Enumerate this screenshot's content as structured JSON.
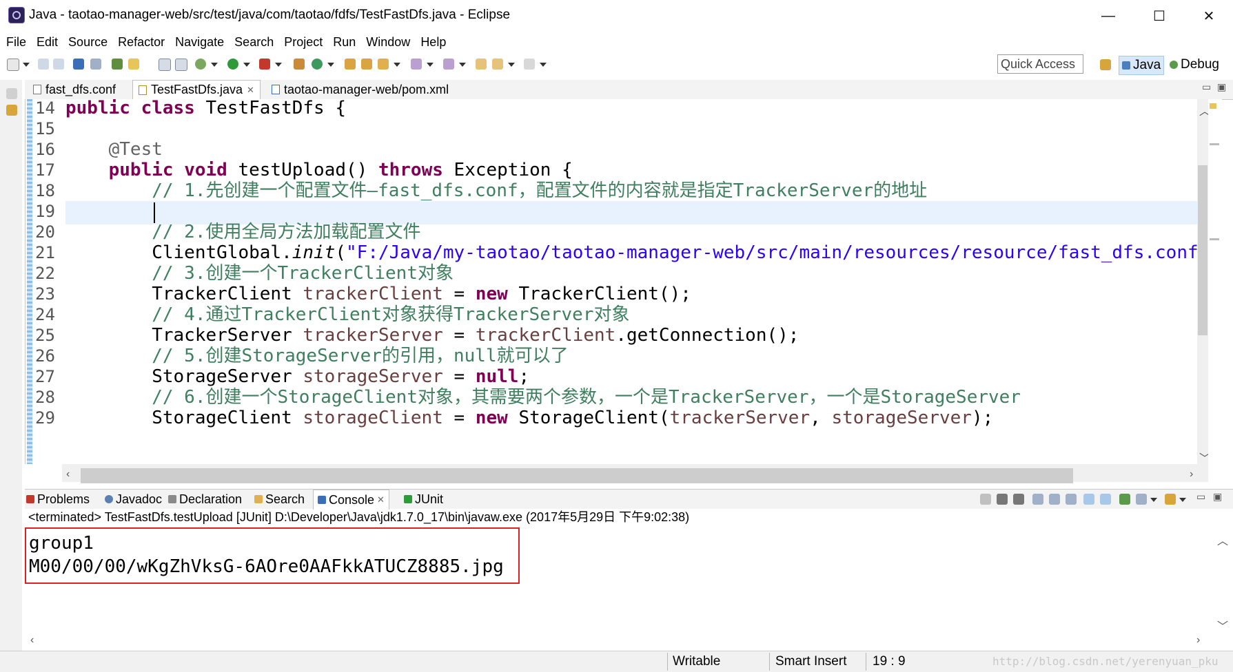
{
  "window": {
    "title": "Java - taotao-manager-web/src/test/java/com/taotao/fdfs/TestFastDfs.java - Eclipse",
    "minimize": "—",
    "maximize": "☐",
    "close": "✕"
  },
  "menu": [
    "File",
    "Edit",
    "Source",
    "Refactor",
    "Navigate",
    "Search",
    "Project",
    "Run",
    "Window",
    "Help"
  ],
  "toolbar": {
    "quick_access": "Quick Access",
    "perspectives": [
      "Java",
      "Debug"
    ]
  },
  "editor": {
    "tabs": [
      {
        "label": "fast_dfs.conf"
      },
      {
        "label": "TestFastDfs.java",
        "active": true
      },
      {
        "label": "taotao-manager-web/pom.xml"
      }
    ],
    "current_line": 19,
    "lines": [
      {
        "n": "14",
        "tokens": [
          {
            "t": "public class",
            "c": "kw"
          },
          {
            "t": " TestFastDfs {",
            "c": ""
          }
        ]
      },
      {
        "n": "15",
        "tokens": []
      },
      {
        "n": "16",
        "tokens": [
          {
            "t": "    ",
            "c": ""
          },
          {
            "t": "@Test",
            "c": "ann"
          }
        ]
      },
      {
        "n": "17",
        "tokens": [
          {
            "t": "    ",
            "c": ""
          },
          {
            "t": "public void",
            "c": "kw"
          },
          {
            "t": " testUpload() ",
            "c": ""
          },
          {
            "t": "throws",
            "c": "kw"
          },
          {
            "t": " Exception {",
            "c": ""
          }
        ]
      },
      {
        "n": "18",
        "tokens": [
          {
            "t": "        // 1.先创建一个配置文件—fast_dfs.conf，配置文件的内容就是指定TrackerServer的地址",
            "c": "cm"
          }
        ]
      },
      {
        "n": "19",
        "tokens": []
      },
      {
        "n": "20",
        "tokens": [
          {
            "t": "        // 2.使用全局方法加载配置文件",
            "c": "cm"
          }
        ]
      },
      {
        "n": "21",
        "tokens": [
          {
            "t": "        ClientGlobal.",
            "c": ""
          },
          {
            "t": "init",
            "c": "it"
          },
          {
            "t": "(",
            "c": ""
          },
          {
            "t": "\"F:/Java/my-taotao/taotao-manager-web/src/main/resources/resource/fast_dfs.conf\"",
            "c": "str"
          },
          {
            "t": ");",
            "c": ""
          }
        ]
      },
      {
        "n": "22",
        "tokens": [
          {
            "t": "        // 3.创建一个TrackerClient对象",
            "c": "cm"
          }
        ]
      },
      {
        "n": "23",
        "tokens": [
          {
            "t": "        TrackerClient ",
            "c": ""
          },
          {
            "t": "trackerClient",
            "c": "fld"
          },
          {
            "t": " = ",
            "c": ""
          },
          {
            "t": "new",
            "c": "kw"
          },
          {
            "t": " TrackerClient();",
            "c": ""
          }
        ]
      },
      {
        "n": "24",
        "tokens": [
          {
            "t": "        // 4.通过TrackerClient对象获得TrackerServer对象",
            "c": "cm"
          }
        ]
      },
      {
        "n": "25",
        "tokens": [
          {
            "t": "        TrackerServer ",
            "c": ""
          },
          {
            "t": "trackerServer",
            "c": "fld"
          },
          {
            "t": " = ",
            "c": ""
          },
          {
            "t": "trackerClient",
            "c": "fld"
          },
          {
            "t": ".getConnection();",
            "c": ""
          }
        ]
      },
      {
        "n": "26",
        "tokens": [
          {
            "t": "        // 5.创建StorageServer的引用，null就可以了",
            "c": "cm"
          }
        ]
      },
      {
        "n": "27",
        "tokens": [
          {
            "t": "        StorageServer ",
            "c": ""
          },
          {
            "t": "storageServer",
            "c": "fld"
          },
          {
            "t": " = ",
            "c": ""
          },
          {
            "t": "null",
            "c": "kw"
          },
          {
            "t": ";",
            "c": ""
          }
        ]
      },
      {
        "n": "28",
        "tokens": [
          {
            "t": "        // 6.创建一个StorageClient对象，其需要两个参数，一个是TrackerServer，一个是StorageServer",
            "c": "cm"
          }
        ]
      },
      {
        "n": "29",
        "tokens": [
          {
            "t": "        StorageClient ",
            "c": ""
          },
          {
            "t": "storageClient",
            "c": "fld"
          },
          {
            "t": " = ",
            "c": ""
          },
          {
            "t": "new",
            "c": "kw"
          },
          {
            "t": " StorageClient(",
            "c": ""
          },
          {
            "t": "trackerServer",
            "c": "fld"
          },
          {
            "t": ", ",
            "c": ""
          },
          {
            "t": "storageServer",
            "c": "fld"
          },
          {
            "t": ");",
            "c": ""
          }
        ]
      }
    ]
  },
  "console": {
    "tabs": [
      {
        "label": "Problems"
      },
      {
        "label": "Javadoc"
      },
      {
        "label": "Declaration"
      },
      {
        "label": "Search"
      },
      {
        "label": "Console",
        "active": true
      },
      {
        "label": "JUnit"
      }
    ],
    "header": "<terminated> TestFastDfs.testUpload [JUnit] D:\\Developer\\Java\\jdk1.7.0_17\\bin\\javaw.exe (2017年5月29日 下午9:02:38)",
    "output": [
      "group1",
      "M00/00/00/wKgZhVksG-6AOre0AAFkkATUCZ8885.jpg"
    ]
  },
  "status": {
    "writable": "Writable",
    "insert_mode": "Smart Insert",
    "position": "19 : 9",
    "watermark": "http://blog.csdn.net/yerenyuan_pku"
  },
  "colors": {
    "keyword": "#7f0055",
    "comment": "#3f7f5f",
    "string": "#2a00ff",
    "field": "#6a3e3e",
    "highlight_box": "#e02020"
  }
}
